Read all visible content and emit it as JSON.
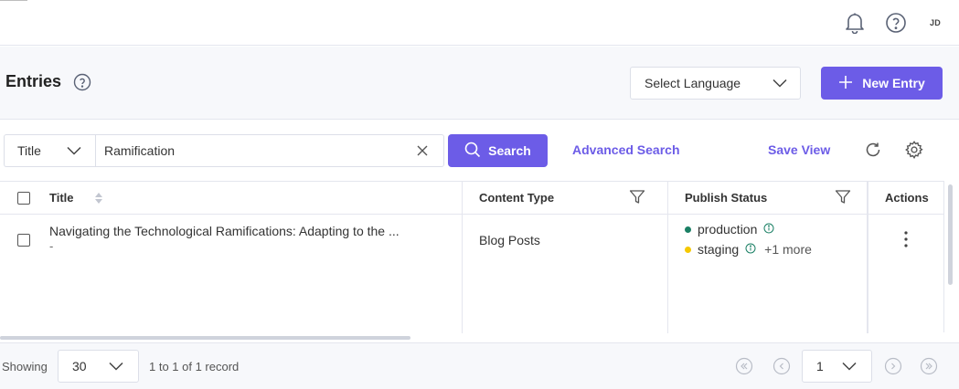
{
  "topbar": {
    "icons": [
      "bell-icon",
      "help-circle-icon"
    ],
    "avatar_initials": "JD"
  },
  "header": {
    "title": "Entries",
    "language_select": {
      "label": "Select Language"
    },
    "new_entry_label": "New Entry"
  },
  "search": {
    "field_select": "Title",
    "query": "Ramification",
    "button_label": "Search",
    "advanced_label": "Advanced Search",
    "save_view_label": "Save View"
  },
  "table": {
    "columns": [
      "Title",
      "Content Type",
      "Publish Status",
      "Actions"
    ],
    "rows": [
      {
        "title": "Navigating the Technological Ramifications: Adapting to the ...",
        "subtitle": "-",
        "content_type": "Blog Posts",
        "statuses": [
          {
            "env": "production",
            "color": "#1a7f64"
          },
          {
            "env": "staging",
            "color": "#f5c800",
            "more": "+1 more"
          }
        ]
      }
    ]
  },
  "footer": {
    "showing_label": "Showing",
    "per_page": "30",
    "record_text": "1 to 1 of 1 record",
    "current_page": "1"
  },
  "colors": {
    "accent": "#6c5ce7",
    "border": "#e4e6ee",
    "header_bg": "#f7f8fb"
  }
}
